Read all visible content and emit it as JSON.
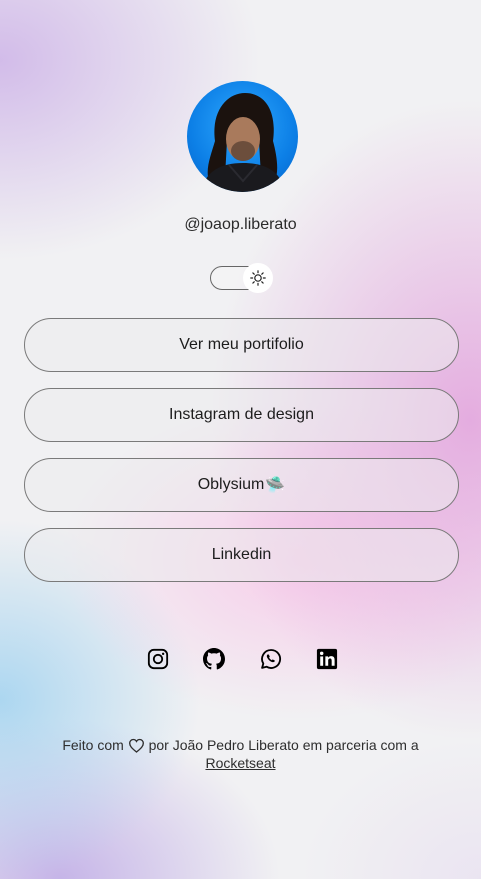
{
  "profile": {
    "username": "@joaop.liberato",
    "avatar_icon": "profile-photo"
  },
  "theme_toggle": {
    "icon": "sun-icon",
    "state": "light"
  },
  "links": [
    {
      "label": "Ver meu portifolio",
      "emoji": ""
    },
    {
      "label": "Instagram de design",
      "emoji": ""
    },
    {
      "label": "Oblysium",
      "emoji": "🛸"
    },
    {
      "label": "Linkedin",
      "emoji": ""
    }
  ],
  "socials": [
    {
      "icon": "instagram-icon"
    },
    {
      "icon": "github-icon"
    },
    {
      "icon": "whatsapp-icon"
    },
    {
      "icon": "linkedin-icon"
    }
  ],
  "footer": {
    "text_before": "Feito com",
    "text_after": "por João Pedro Liberato em parceria com a",
    "link": "Rocketseat",
    "heart_icon": "heart-icon"
  }
}
